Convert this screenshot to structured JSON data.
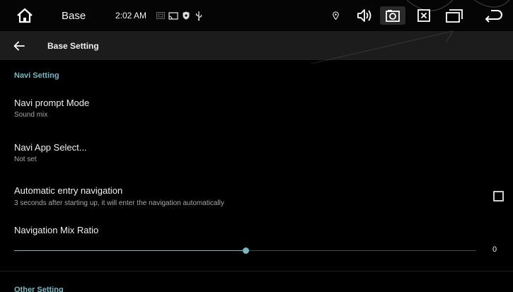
{
  "statusbar": {
    "app_name": "Base",
    "time": "2:02 AM"
  },
  "appbar": {
    "title": "Base Setting"
  },
  "navi_section": {
    "header": "Navi Setting",
    "items": [
      {
        "title": "Navi prompt Mode",
        "subtitle": "Sound mix"
      },
      {
        "title": "Navi App Select...",
        "subtitle": "Not set"
      },
      {
        "title": "Automatic entry navigation",
        "subtitle": "3 seconds after starting up, it will enter the navigation automatically",
        "checked": false
      }
    ],
    "mix_ratio": {
      "title": "Navigation Mix Ratio",
      "value_label": "0",
      "fill_fraction": 0.5
    }
  },
  "other_section": {
    "header": "Other Setting"
  },
  "colors": {
    "accent": "#7ab8c0",
    "background": "#000000",
    "appbar": "#1c1c1c"
  }
}
